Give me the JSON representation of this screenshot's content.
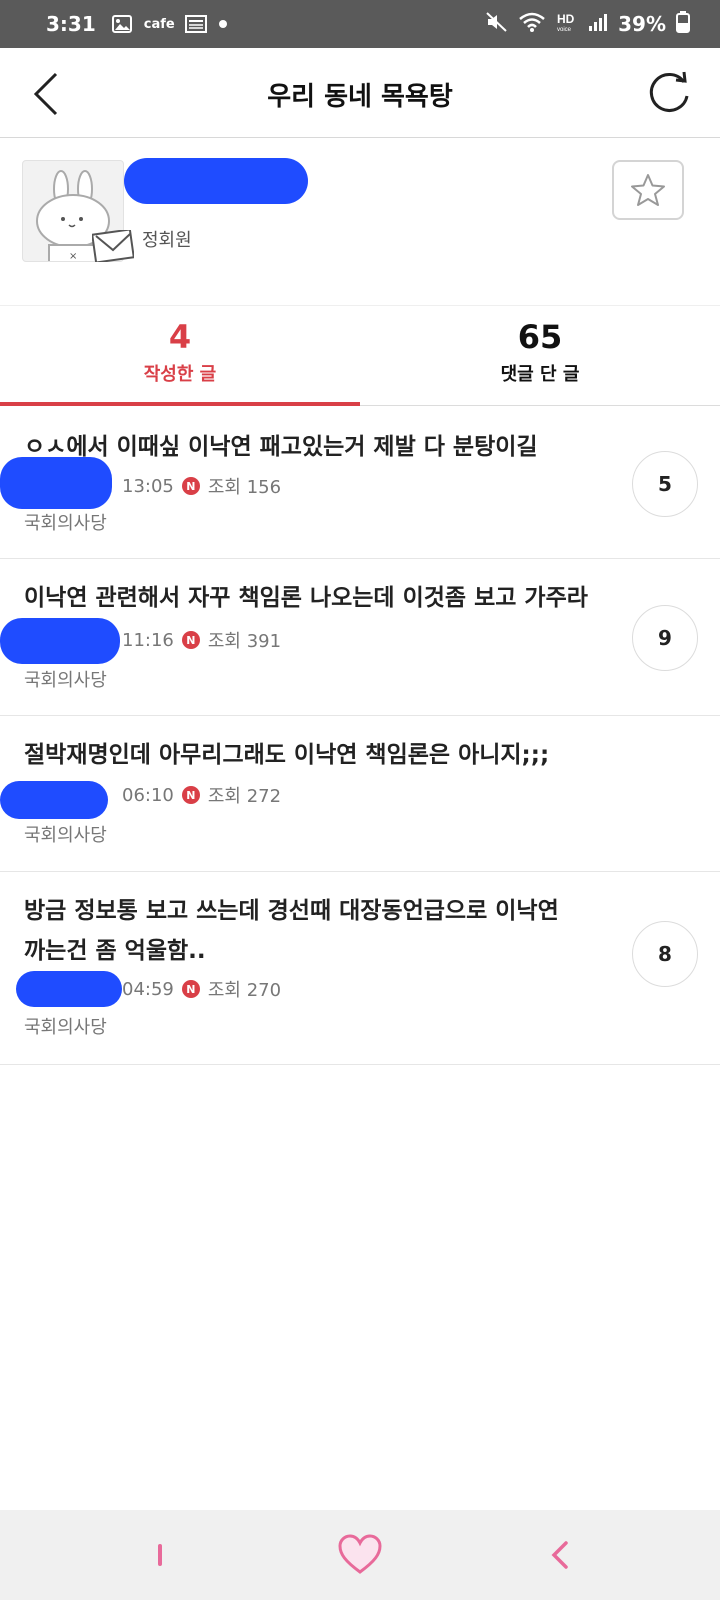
{
  "status_bar": {
    "time": "3:31",
    "cafe_label": "cafe",
    "battery": "39%"
  },
  "header": {
    "title": "우리 동네 목욕탕",
    "back_icon": "chevron-left-icon",
    "refresh_icon": "refresh-icon"
  },
  "profile": {
    "grade": "정회원",
    "favorite_icon": "star-icon"
  },
  "tabs": [
    {
      "count": "4",
      "label": "작성한 글",
      "active": true
    },
    {
      "count": "65",
      "label": "댓글 단 글",
      "active": false
    }
  ],
  "posts": [
    {
      "title": "ㅇㅅ에서 이때싶 이낙연 패고있는거 제발 다 분탕이길",
      "time": "13:05",
      "badge": "N",
      "views": "조회 156",
      "board": "국회의사당",
      "comments": "5"
    },
    {
      "title": "이낙연 관련해서 자꾸 책임론 나오는데 이것좀 보고 가주라",
      "time": "11:16",
      "badge": "N",
      "views": "조회 391",
      "board": "국회의사당",
      "comments": "9"
    },
    {
      "title": "절박재명인데 아무리그래도 이낙연 책임론은 아니지;;;",
      "time": "06:10",
      "badge": "N",
      "views": "조회 272",
      "board": "국회의사당",
      "comments": ""
    },
    {
      "title": "방금 정보통 보고 쓰는데 경선때 대장동언급으로 이낙연 까는건 좀 억울함..",
      "time": "04:59",
      "badge": "N",
      "views": "조회 270",
      "board": "국회의사당",
      "comments": "8"
    }
  ],
  "bottom_nav": {
    "left_icon": "cursor-bar-icon",
    "center_icon": "heart-icon",
    "right_icon": "chevron-left-icon",
    "accent": "#e86a9a"
  },
  "colors": {
    "accent": "#d93f47",
    "redaction": "#1f4cff",
    "status_bar": "#5a5a5a"
  }
}
